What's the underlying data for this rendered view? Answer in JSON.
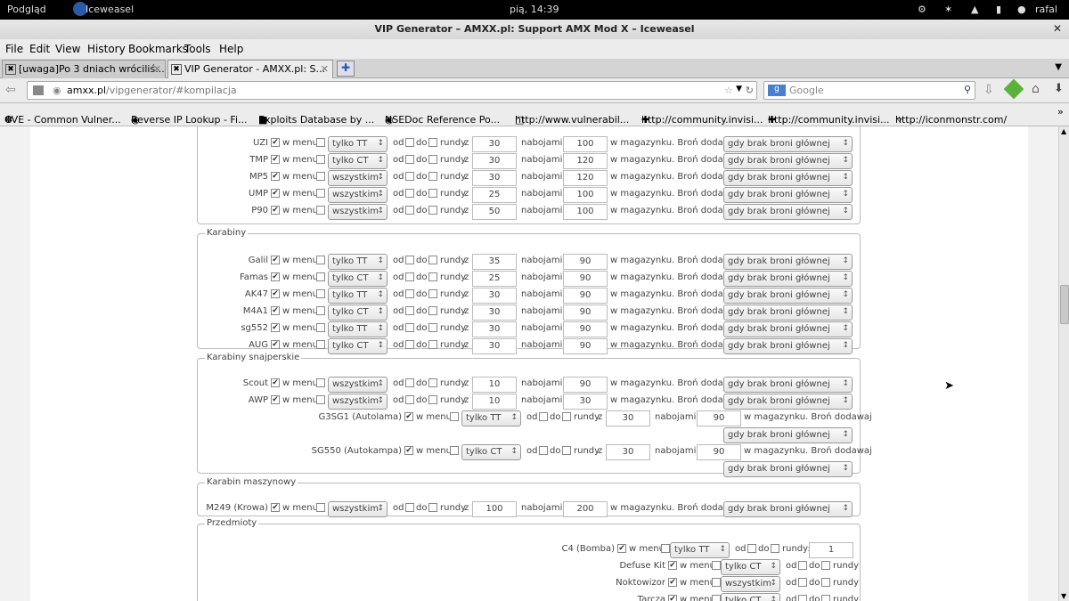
{
  "os": {
    "app": "Podgląd",
    "browser": "Iceweasel",
    "clock": "pią, 14:39",
    "user": "rafal"
  },
  "window": {
    "title": "VIP Generator – AMXX.pl: Support AMX Mod X – Iceweasel"
  },
  "menu": [
    "File",
    "Edit",
    "View",
    "History",
    "Bookmarks",
    "Tools",
    "Help"
  ],
  "tabs": [
    "[uwaga]Po 3 dniach wróciliś...",
    "VIP Generator - AMXX.pl: S..."
  ],
  "url": {
    "host": "amxx.pl",
    "path": "/vipgenerator/#kompilacja"
  },
  "search": {
    "placeholder": "Google"
  },
  "bookmarks": [
    "CVE - Common Vulner...",
    "Reverse IP Lookup - Fi...",
    "Exploits Database by ...",
    "NSEDoc Reference Po...",
    "http://www.vulnerabil...",
    "http://community.invisi...",
    "http://community.invisi...",
    "http://iconmonstr.com/"
  ],
  "labels": {
    "menu": "w menu",
    "od": "od",
    "do": "do",
    "rundy": "rundy",
    "z": "z",
    "nabojami": "nabojami i",
    "magazynku": "w magazynku. Broń dodawaj",
    "rundy_colon": "rundy:"
  },
  "groups": [
    {
      "legend": "",
      "rows": [
        {
          "name": "UZI",
          "team": "tylko TT",
          "a": "30",
          "b": "100",
          "mode": "gdy brak broni głównej"
        },
        {
          "name": "TMP",
          "team": "tylko CT",
          "a": "30",
          "b": "120",
          "mode": "gdy brak broni głównej"
        },
        {
          "name": "MP5",
          "team": "wszystkim",
          "a": "30",
          "b": "120",
          "mode": "gdy brak broni głównej"
        },
        {
          "name": "UMP",
          "team": "wszystkim",
          "a": "25",
          "b": "100",
          "mode": "gdy brak broni głównej"
        },
        {
          "name": "P90",
          "team": "wszystkim",
          "a": "50",
          "b": "100",
          "mode": "gdy brak broni głównej"
        }
      ]
    },
    {
      "legend": "Karabiny",
      "rows": [
        {
          "name": "Galil",
          "team": "tylko TT",
          "a": "35",
          "b": "90",
          "mode": "gdy brak broni głównej"
        },
        {
          "name": "Famas",
          "team": "tylko CT",
          "a": "25",
          "b": "90",
          "mode": "gdy brak broni głównej"
        },
        {
          "name": "AK47",
          "team": "tylko TT",
          "a": "30",
          "b": "90",
          "mode": "gdy brak broni głównej"
        },
        {
          "name": "M4A1",
          "team": "tylko CT",
          "a": "30",
          "b": "90",
          "mode": "gdy brak broni głównej"
        },
        {
          "name": "sg552",
          "team": "tylko TT",
          "a": "30",
          "b": "90",
          "mode": "gdy brak broni głównej"
        },
        {
          "name": "AUG",
          "team": "tylko CT",
          "a": "30",
          "b": "90",
          "mode": "gdy brak broni głównej"
        }
      ]
    },
    {
      "legend": "Karabiny snajperskie",
      "rows": [
        {
          "name": "Scout",
          "team": "wszystkim",
          "a": "10",
          "b": "90",
          "mode": "gdy brak broni głównej"
        },
        {
          "name": "AWP",
          "team": "wszystkim",
          "a": "10",
          "b": "30",
          "mode": "gdy brak broni głównej"
        },
        {
          "name": "G3SG1 (Autolama)",
          "team": "tylko TT",
          "a": "30",
          "b": "90",
          "mode": "gdy brak broni głównej"
        },
        {
          "name": "SG550 (Autokampa)",
          "team": "tylko CT",
          "a": "30",
          "b": "90",
          "mode": "gdy brak broni głównej"
        }
      ]
    },
    {
      "legend": "Karabin maszynowy",
      "rows": [
        {
          "name": "M249 (Krowa)",
          "team": "wszystkim",
          "a": "100",
          "b": "200",
          "mode": "gdy brak broni głównej"
        }
      ]
    },
    {
      "legend": "Przedmioty",
      "rows": [
        {
          "name": "C4 (Bomba)",
          "team": "tylko TT",
          "rounds": "1"
        },
        {
          "name": "Defuse Kit",
          "team": "tylko CT"
        },
        {
          "name": "Noktowizor",
          "team": "wszystkim"
        },
        {
          "name": "Tarcza",
          "team": "tylko CT"
        }
      ]
    }
  ]
}
